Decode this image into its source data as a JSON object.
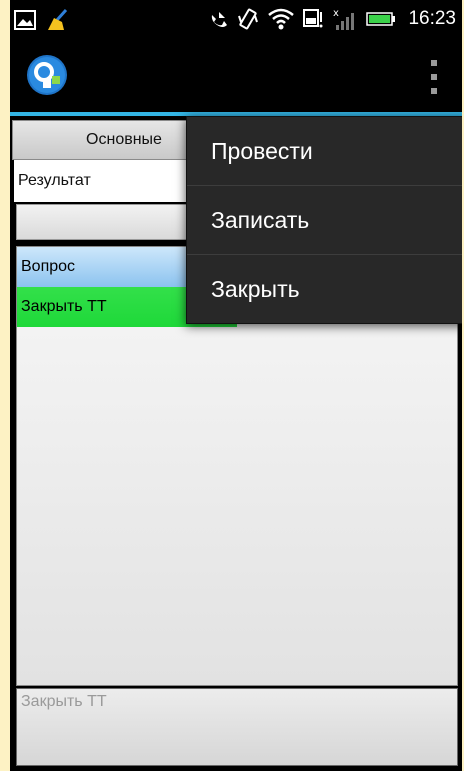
{
  "status_bar": {
    "time": "16:23",
    "icons": [
      "image-notification-icon",
      "cleaner-broom-icon",
      "missed-call-icon",
      "vibrate-icon",
      "wifi-icon",
      "sd-card-icon",
      "signal-icon",
      "battery-icon"
    ]
  },
  "action_bar": {
    "logo": "app-logo-icon",
    "overflow": "overflow-menu-icon",
    "accent_color": "#33b5e5"
  },
  "tabs": [
    {
      "label": "Основные"
    },
    {
      "label": ""
    }
  ],
  "form": {
    "result_label": "Результат",
    "result_value": ""
  },
  "list": {
    "rows": [
      {
        "label": "Вопрос",
        "color": "#8cc3ef"
      },
      {
        "label": "Закрыть ТТ",
        "color": "#1ed839"
      }
    ]
  },
  "footer": {
    "text": "Закрыть ТТ"
  },
  "menu": {
    "items": [
      {
        "label": "Провести"
      },
      {
        "label": "Записать"
      },
      {
        "label": "Закрыть"
      }
    ]
  }
}
